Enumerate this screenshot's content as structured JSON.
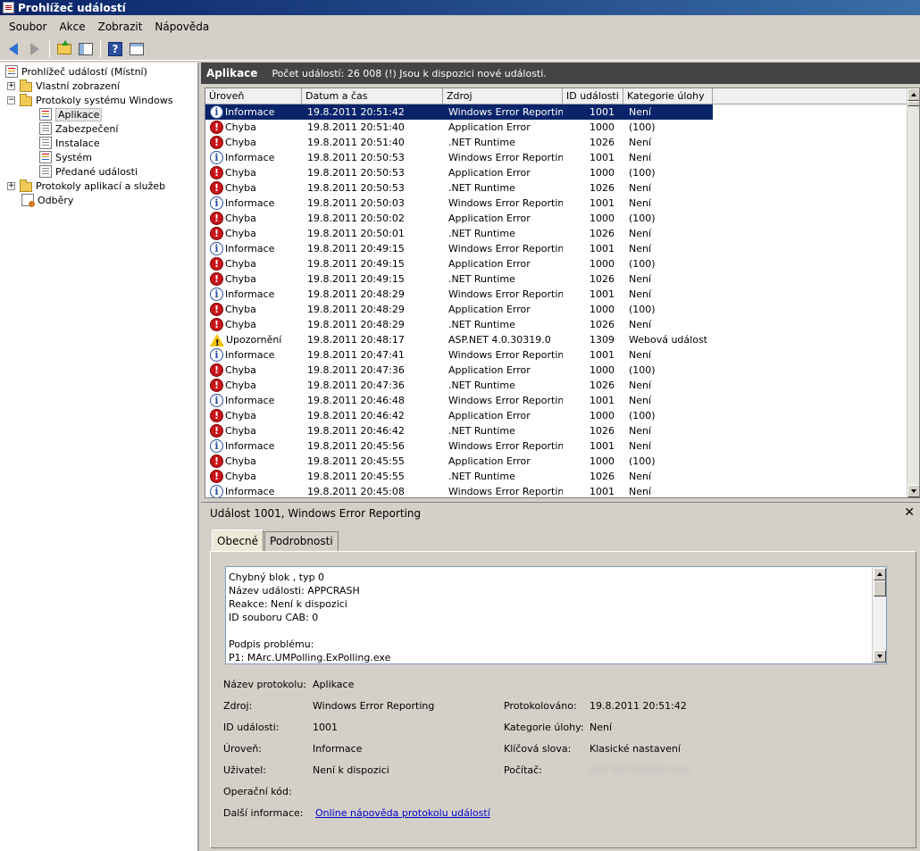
{
  "window": {
    "title": "Prohlížeč událostí"
  },
  "menu": [
    "Soubor",
    "Akce",
    "Zobrazit",
    "Nápověda"
  ],
  "tree": {
    "root": "Prohlížeč událostí (Místní)",
    "custom_views": "Vlastní zobrazení",
    "windows_logs": "Protokoly systému Windows",
    "logs": [
      "Aplikace",
      "Zabezpečení",
      "Instalace",
      "Systém",
      "Předané události"
    ],
    "app_service_logs": "Protokoly aplikací a služeb",
    "subscriptions": "Odběry"
  },
  "content": {
    "title": "Aplikace",
    "info": "Počet událostí: 26 008 (!) Jsou k dispozici nové události."
  },
  "grid": {
    "columns": [
      "Úroveň",
      "Datum a čas",
      "Zdroj",
      "ID události",
      "Kategorie úlohy"
    ],
    "rows": [
      {
        "level": "Informace",
        "type": "info",
        "datetime": "19.8.2011 20:51:42",
        "source": "Windows Error Reporting",
        "id": "1001",
        "category": "Není"
      },
      {
        "level": "Chyba",
        "type": "error",
        "datetime": "19.8.2011 20:51:40",
        "source": "Application Error",
        "id": "1000",
        "category": "(100)"
      },
      {
        "level": "Chyba",
        "type": "error",
        "datetime": "19.8.2011 20:51:40",
        "source": ".NET Runtime",
        "id": "1026",
        "category": "Není"
      },
      {
        "level": "Informace",
        "type": "info",
        "datetime": "19.8.2011 20:50:53",
        "source": "Windows Error Reporting",
        "id": "1001",
        "category": "Není"
      },
      {
        "level": "Chyba",
        "type": "error",
        "datetime": "19.8.2011 20:50:53",
        "source": "Application Error",
        "id": "1000",
        "category": "(100)"
      },
      {
        "level": "Chyba",
        "type": "error",
        "datetime": "19.8.2011 20:50:53",
        "source": ".NET Runtime",
        "id": "1026",
        "category": "Není"
      },
      {
        "level": "Informace",
        "type": "info",
        "datetime": "19.8.2011 20:50:03",
        "source": "Windows Error Reporting",
        "id": "1001",
        "category": "Není"
      },
      {
        "level": "Chyba",
        "type": "error",
        "datetime": "19.8.2011 20:50:02",
        "source": "Application Error",
        "id": "1000",
        "category": "(100)"
      },
      {
        "level": "Chyba",
        "type": "error",
        "datetime": "19.8.2011 20:50:01",
        "source": ".NET Runtime",
        "id": "1026",
        "category": "Není"
      },
      {
        "level": "Informace",
        "type": "info",
        "datetime": "19.8.2011 20:49:15",
        "source": "Windows Error Reporting",
        "id": "1001",
        "category": "Není"
      },
      {
        "level": "Chyba",
        "type": "error",
        "datetime": "19.8.2011 20:49:15",
        "source": "Application Error",
        "id": "1000",
        "category": "(100)"
      },
      {
        "level": "Chyba",
        "type": "error",
        "datetime": "19.8.2011 20:49:15",
        "source": ".NET Runtime",
        "id": "1026",
        "category": "Není"
      },
      {
        "level": "Informace",
        "type": "info",
        "datetime": "19.8.2011 20:48:29",
        "source": "Windows Error Reporting",
        "id": "1001",
        "category": "Není"
      },
      {
        "level": "Chyba",
        "type": "error",
        "datetime": "19.8.2011 20:48:29",
        "source": "Application Error",
        "id": "1000",
        "category": "(100)"
      },
      {
        "level": "Chyba",
        "type": "error",
        "datetime": "19.8.2011 20:48:29",
        "source": ".NET Runtime",
        "id": "1026",
        "category": "Není"
      },
      {
        "level": "Upozornění",
        "type": "warn",
        "datetime": "19.8.2011 20:48:17",
        "source": "ASP.NET 4.0.30319.0",
        "id": "1309",
        "category": "Webová událost"
      },
      {
        "level": "Informace",
        "type": "info",
        "datetime": "19.8.2011 20:47:41",
        "source": "Windows Error Reporting",
        "id": "1001",
        "category": "Není"
      },
      {
        "level": "Chyba",
        "type": "error",
        "datetime": "19.8.2011 20:47:36",
        "source": "Application Error",
        "id": "1000",
        "category": "(100)"
      },
      {
        "level": "Chyba",
        "type": "error",
        "datetime": "19.8.2011 20:47:36",
        "source": ".NET Runtime",
        "id": "1026",
        "category": "Není"
      },
      {
        "level": "Informace",
        "type": "info",
        "datetime": "19.8.2011 20:46:48",
        "source": "Windows Error Reporting",
        "id": "1001",
        "category": "Není"
      },
      {
        "level": "Chyba",
        "type": "error",
        "datetime": "19.8.2011 20:46:42",
        "source": "Application Error",
        "id": "1000",
        "category": "(100)"
      },
      {
        "level": "Chyba",
        "type": "error",
        "datetime": "19.8.2011 20:46:42",
        "source": ".NET Runtime",
        "id": "1026",
        "category": "Není"
      },
      {
        "level": "Informace",
        "type": "info",
        "datetime": "19.8.2011 20:45:56",
        "source": "Windows Error Reporting",
        "id": "1001",
        "category": "Není"
      },
      {
        "level": "Chyba",
        "type": "error",
        "datetime": "19.8.2011 20:45:55",
        "source": "Application Error",
        "id": "1000",
        "category": "(100)"
      },
      {
        "level": "Chyba",
        "type": "error",
        "datetime": "19.8.2011 20:45:55",
        "source": ".NET Runtime",
        "id": "1026",
        "category": "Není"
      },
      {
        "level": "Informace",
        "type": "info",
        "datetime": "19.8.2011 20:45:08",
        "source": "Windows Error Reporting",
        "id": "1001",
        "category": "Není"
      }
    ]
  },
  "detail": {
    "title": "Událost 1001, Windows Error Reporting",
    "tabs": [
      "Obecné",
      "Podrobnosti"
    ],
    "description": "Chybný blok , typ 0\nNázev události: APPCRASH\nReakce: Není k dispozici\nID souboru CAB: 0\n\nPodpis problému:\nP1: MArc.UMPolling.ExPolling.exe",
    "labels": {
      "log_name": "Název protokolu:",
      "source": "Zdroj:",
      "event_id": "ID události:",
      "level": "Úroveň:",
      "user": "Uživatel:",
      "opcode": "Operační kód:",
      "more_info": "Další informace:",
      "logged": "Protokolováno:",
      "task_category": "Kategorie úlohy:",
      "keywords": "Klíčová slova:",
      "computer": "Počítač:"
    },
    "values": {
      "log_name": "Aplikace",
      "source": "Windows Error Reporting",
      "event_id": "1001",
      "level": "Informace",
      "user": "Není k dispozici",
      "opcode": "",
      "more_info_link": "Online nápověda protokolu událostí",
      "logged": "19.8.2011 20:51:42",
      "task_category": "Není",
      "keywords": "Klasické nastavení",
      "computer": "SRV-NETTRANS.local"
    }
  }
}
